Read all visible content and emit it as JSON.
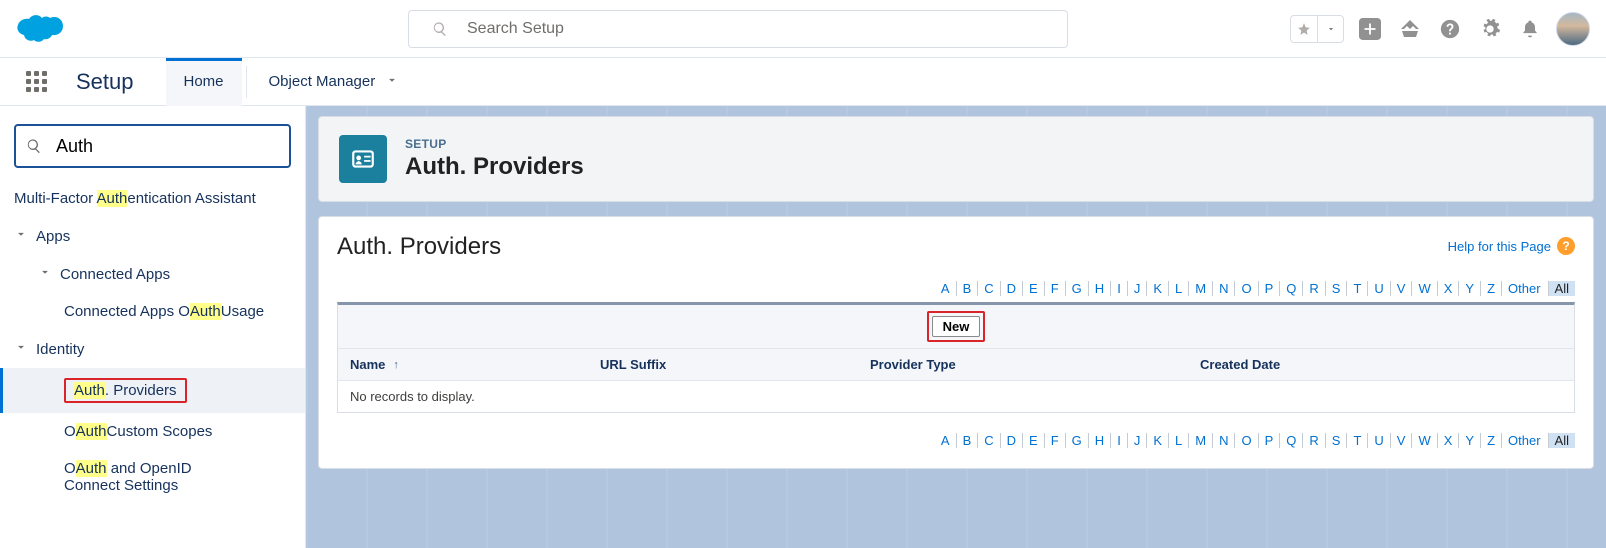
{
  "header": {
    "search_placeholder": "Search Setup"
  },
  "nav": {
    "app_title": "Setup",
    "tab_home": "Home",
    "tab_object_manager": "Object Manager"
  },
  "sidebar": {
    "search_value": "Auth",
    "mfa_pre": "Multi-Factor ",
    "mfa_hl": "Auth",
    "mfa_post": "entication Assistant",
    "apps": "Apps",
    "connected_apps": "Connected Apps",
    "ca_usage_pre": "Connected Apps O",
    "ca_usage_hl": "Auth",
    "ca_usage_post": " Usage",
    "identity": "Identity",
    "auth_prov_pre": "",
    "auth_prov_hl": "Auth",
    "auth_prov_post": ". Providers",
    "cs_pre": "O",
    "cs_hl": "Auth",
    "cs_post": " Custom Scopes",
    "oidc_pre": "O",
    "oidc_hl": "Auth",
    "oidc_post": " and OpenID Connect Settings"
  },
  "page": {
    "eyebrow": "SETUP",
    "title": "Auth. Providers",
    "panel_title": "Auth. Providers",
    "help_text": "Help for this Page",
    "new_btn": "New",
    "az": [
      "A",
      "B",
      "C",
      "D",
      "E",
      "F",
      "G",
      "H",
      "I",
      "J",
      "K",
      "L",
      "M",
      "N",
      "O",
      "P",
      "Q",
      "R",
      "S",
      "T",
      "U",
      "V",
      "W",
      "X",
      "Y",
      "Z"
    ],
    "az_other": "Other",
    "az_all": "All",
    "col_name": "Name",
    "col_url": "URL Suffix",
    "col_ptype": "Provider Type",
    "col_cdate": "Created Date",
    "empty": "No records to display."
  }
}
